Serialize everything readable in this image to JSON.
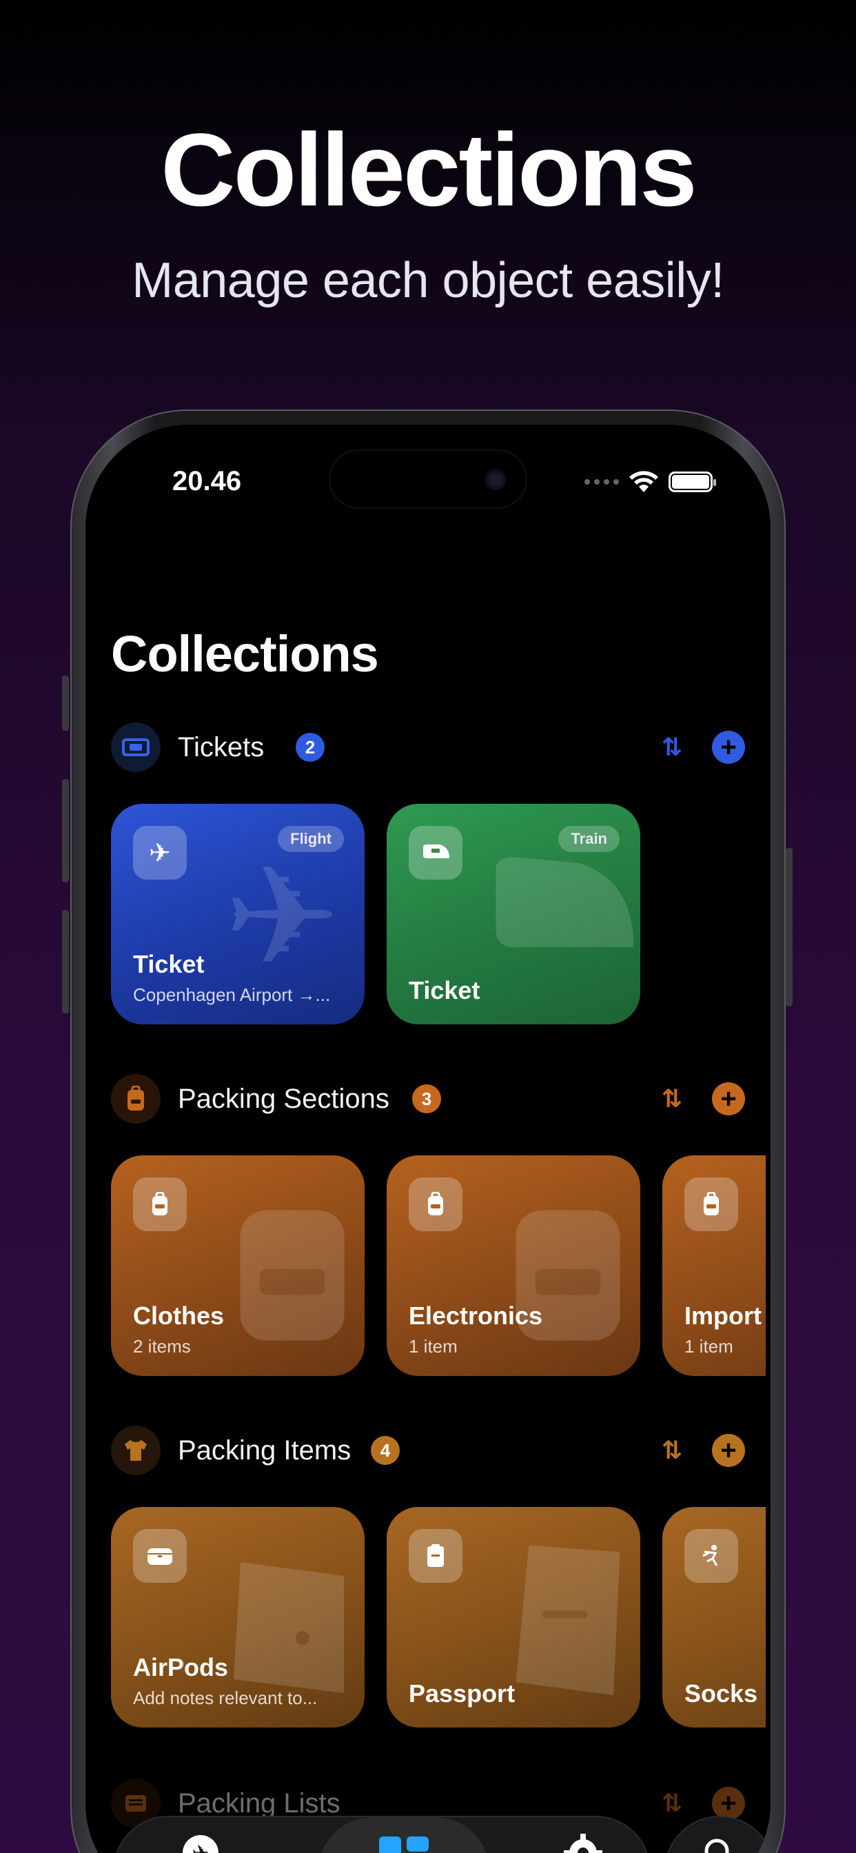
{
  "hero": {
    "title": "Collections",
    "subtitle": "Manage each object easily!"
  },
  "status_bar": {
    "time": "20.46"
  },
  "screen": {
    "title": "Collections"
  },
  "sections": [
    {
      "name": "Tickets",
      "count": "2",
      "accent": "#2f5be0",
      "icon": "ticket-icon",
      "cards": [
        {
          "title": "Ticket",
          "subtitle": "Copenhagen Airport →...",
          "tag": "Flight",
          "icon": "airplane-icon"
        },
        {
          "title": "Ticket",
          "subtitle": "",
          "tag": "Train",
          "icon": "train-icon"
        }
      ]
    },
    {
      "name": "Packing Sections",
      "count": "3",
      "accent": "#c8681f",
      "icon": "backpack-icon",
      "cards": [
        {
          "title": "Clothes",
          "subtitle": "2 items",
          "icon": "backpack-icon"
        },
        {
          "title": "Electronics",
          "subtitle": "1 item",
          "icon": "backpack-icon"
        },
        {
          "title": "Import",
          "subtitle": "1 item",
          "icon": "backpack-icon"
        }
      ]
    },
    {
      "name": "Packing Items",
      "count": "4",
      "accent": "#b87320",
      "icon": "tshirt-icon",
      "cards": [
        {
          "title": "AirPods",
          "subtitle": "Add notes relevant to...",
          "icon": "airpods-case-icon"
        },
        {
          "title": "Passport",
          "subtitle": "",
          "icon": "passport-icon"
        },
        {
          "title": "Socks",
          "subtitle": "",
          "icon": "figure-icon"
        }
      ]
    },
    {
      "name": "Packing Lists",
      "accent": "#c8681f",
      "icon": "list-icon"
    }
  ],
  "tabbar": {
    "tabs": [
      {
        "name": "trips",
        "icon": "airplane-circle-icon"
      },
      {
        "name": "collections",
        "icon": "grid-icon"
      },
      {
        "name": "settings",
        "icon": "gear-icon"
      }
    ],
    "search_icon": "search-icon"
  }
}
